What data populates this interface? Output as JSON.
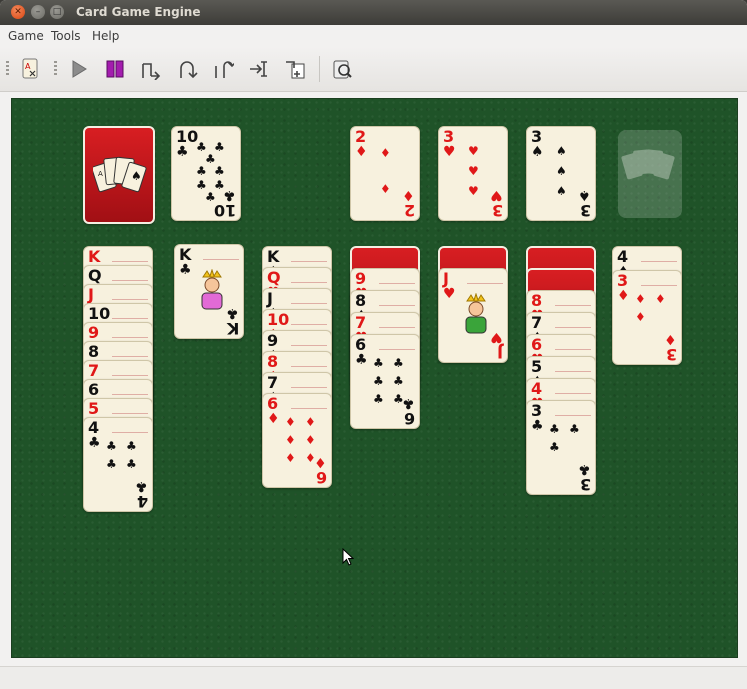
{
  "window": {
    "title": "Card Game Engine"
  },
  "menu": {
    "items": [
      "Game",
      "Tools",
      "Help"
    ]
  },
  "toolbar": {
    "buttons": [
      "game-selector-icon",
      "play-icon",
      "pause-icon",
      "undo-icon",
      "redo-icon",
      "replay-icon",
      "step-icon",
      "deal-icon",
      "hint-icon"
    ]
  },
  "colors": {
    "felt": "#1f5328",
    "red": "#e01818",
    "black": "#111111",
    "card": "#f7f1de"
  },
  "top_row": {
    "talon": {
      "rank": "10",
      "suit": "♣"
    },
    "foundations": [
      {
        "rank": "2",
        "suit": "♦",
        "color": "red"
      },
      {
        "rank": "3",
        "suit": "♥",
        "color": "red"
      },
      {
        "rank": "3",
        "suit": "♠",
        "color": "black"
      }
    ]
  },
  "columns": [
    {
      "cards": [
        {
          "rank": "K",
          "suit": "♥",
          "color": "red"
        },
        {
          "rank": "Q",
          "suit": "♠",
          "color": "black"
        },
        {
          "rank": "J",
          "suit": "♦",
          "color": "red"
        },
        {
          "rank": "10",
          "suit": "♠",
          "color": "black"
        },
        {
          "rank": "9",
          "suit": "♥",
          "color": "red"
        },
        {
          "rank": "8",
          "suit": "♣",
          "color": "black"
        },
        {
          "rank": "7",
          "suit": "♦",
          "color": "red"
        },
        {
          "rank": "6",
          "suit": "♠",
          "color": "black"
        },
        {
          "rank": "5",
          "suit": "♥",
          "color": "red"
        },
        {
          "rank": "4",
          "suit": "♣",
          "color": "black"
        }
      ]
    },
    {
      "cards": [
        {
          "rank": "K",
          "suit": "♣",
          "color": "black"
        }
      ]
    },
    {
      "cards": [
        {
          "rank": "K",
          "suit": "♠",
          "color": "black"
        },
        {
          "rank": "Q",
          "suit": "♥",
          "color": "red"
        },
        {
          "rank": "J",
          "suit": "♠",
          "color": "black"
        },
        {
          "rank": "10",
          "suit": "♦",
          "color": "red"
        },
        {
          "rank": "9",
          "suit": "♠",
          "color": "black"
        },
        {
          "rank": "8",
          "suit": "♦",
          "color": "red"
        },
        {
          "rank": "7",
          "suit": "♠",
          "color": "black"
        },
        {
          "rank": "6",
          "suit": "♦",
          "color": "red"
        }
      ]
    },
    {
      "cards": [
        {
          "rank": "9",
          "suit": "♥",
          "color": "red"
        },
        {
          "rank": "8",
          "suit": "♠",
          "color": "black"
        },
        {
          "rank": "7",
          "suit": "♥",
          "color": "red"
        },
        {
          "rank": "6",
          "suit": "♣",
          "color": "black"
        }
      ]
    },
    {
      "cards": [
        {
          "rank": "J",
          "suit": "♥",
          "color": "red"
        }
      ]
    },
    {
      "cards": [
        {
          "rank": "8",
          "suit": "♥",
          "color": "red"
        },
        {
          "rank": "7",
          "suit": "♠",
          "color": "black"
        },
        {
          "rank": "6",
          "suit": "♥",
          "color": "red"
        },
        {
          "rank": "5",
          "suit": "♠",
          "color": "black"
        },
        {
          "rank": "4",
          "suit": "♥",
          "color": "red"
        },
        {
          "rank": "3",
          "suit": "♣",
          "color": "black"
        }
      ]
    },
    {
      "cards": [
        {
          "rank": "4",
          "suit": "♠",
          "color": "black"
        },
        {
          "rank": "3",
          "suit": "♦",
          "color": "red"
        }
      ]
    }
  ]
}
